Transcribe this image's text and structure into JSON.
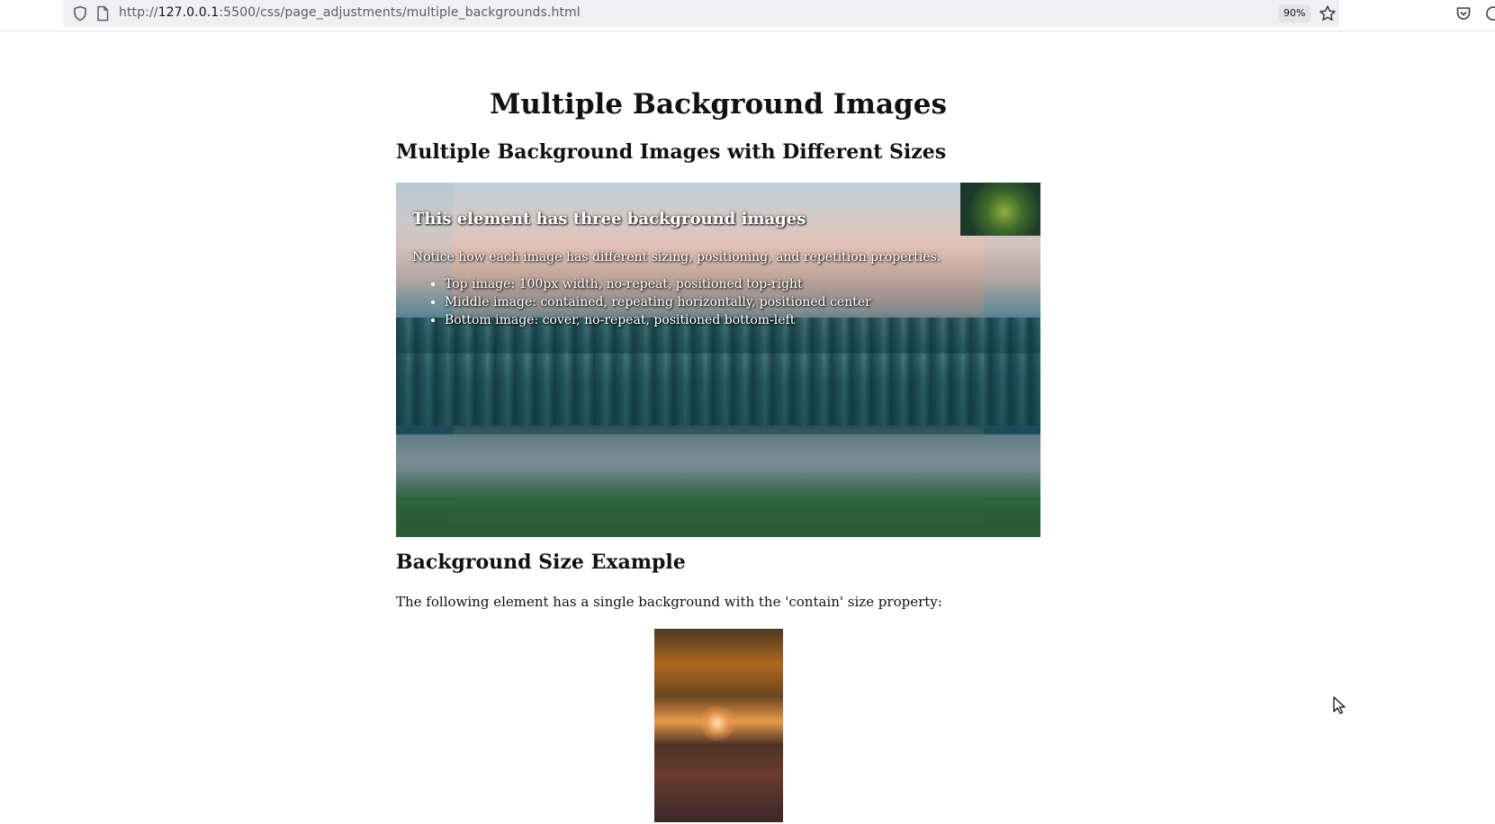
{
  "browser": {
    "url_prefix": "http://",
    "url_host": "127.0.0.1",
    "url_rest": ":5500/css/page_adjustments/multiple_backgrounds.html",
    "zoom": "90%",
    "icons": [
      "shield-icon",
      "page-icon",
      "star-icon",
      "pocket-icon",
      "account-icon"
    ]
  },
  "page": {
    "title": "Multiple Background Images",
    "section1": {
      "heading": "Multiple Background Images with Different Sizes",
      "box_heading": "This element has three background images",
      "box_text": "Notice how each image has different sizing, positioning, and repetition properties.",
      "items": [
        "Top image: 100px width, no-repeat, positioned top-right",
        "Middle image: contained, repeating horizontally, positioned center",
        "Bottom image: cover, no-repeat, positioned bottom-left"
      ]
    },
    "section2": {
      "heading": "Background Size Example",
      "text": "The following element has a single background with the 'contain' size property:"
    }
  }
}
